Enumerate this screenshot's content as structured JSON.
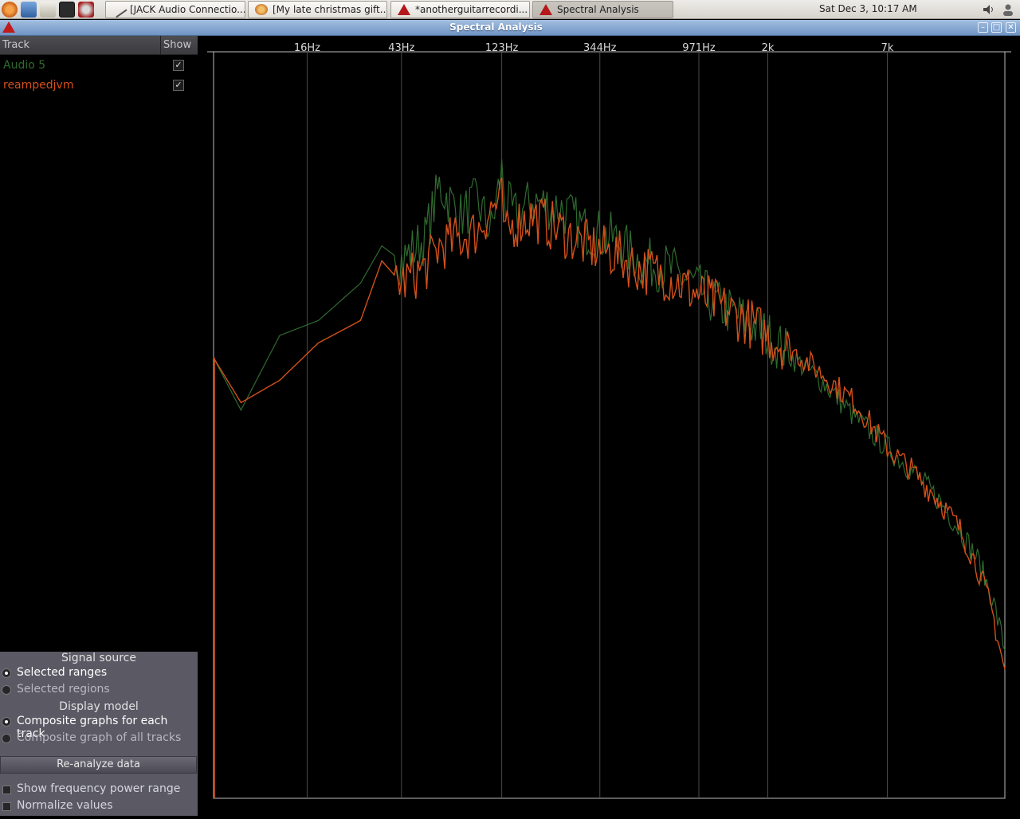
{
  "taskbar": {
    "tasks": [
      {
        "label": "[JACK Audio Connectio..."
      },
      {
        "label": "[My late christmas gift..."
      },
      {
        "label": "*anotherguitarrecordi..."
      },
      {
        "label": "Spectral Analysis"
      }
    ],
    "clock": "Sat Dec  3, 10:17 AM"
  },
  "window": {
    "title": "Spectral Analysis"
  },
  "track_list": {
    "col_track": "Track",
    "col_show": "Show",
    "tracks": [
      {
        "name": "Audio 5",
        "color": "#2f6b2f",
        "shown": true
      },
      {
        "name": "reampedjvm",
        "color": "#d4501a",
        "shown": true
      }
    ]
  },
  "controls": {
    "signal_source_label": "Signal source",
    "source_options": [
      "Selected ranges",
      "Selected regions"
    ],
    "source_selected": 0,
    "display_model_label": "Display model",
    "display_options": [
      "Composite graphs for each track",
      "Composite graph of all tracks"
    ],
    "display_selected": 0,
    "reanalyze_label": "Re-analyze data",
    "show_power_range_label": "Show frequency power range",
    "show_power_range": false,
    "normalize_label": "Normalize values",
    "normalize": false
  },
  "chart_data": {
    "type": "line",
    "x_scale": "log",
    "x_ticks": [
      "16Hz",
      "43Hz",
      "123Hz",
      "344Hz",
      "971Hz",
      "2k",
      "7k"
    ],
    "x_tick_values": [
      16,
      43,
      123,
      344,
      971,
      2000,
      7000
    ],
    "xlim": [
      6,
      24000
    ],
    "ylim": [
      0,
      100
    ],
    "grid": true,
    "series": [
      {
        "name": "Audio 5",
        "color": "#2f6b2f",
        "x": [
          6,
          8,
          12,
          18,
          28,
          35,
          43,
          55,
          64,
          80,
          95,
          110,
          123,
          128,
          140,
          170,
          230,
          300,
          400,
          520,
          700,
          900,
          1200,
          1600,
          2000,
          2600,
          3500,
          5000,
          7000,
          9000,
          12000,
          15000,
          18000,
          21000,
          24000
        ],
        "y": [
          59,
          52,
          62,
          64,
          69,
          74,
          72,
          75,
          82,
          78,
          80,
          76,
          84,
          80,
          78,
          80,
          79,
          76,
          75,
          72,
          71,
          69,
          66,
          64,
          62,
          59,
          56,
          51,
          47,
          44,
          40,
          36,
          32,
          27,
          20
        ]
      },
      {
        "name": "reampedjvm",
        "color": "#d4501a",
        "x": [
          6,
          8,
          12,
          18,
          28,
          35,
          43,
          55,
          64,
          80,
          95,
          110,
          123,
          128,
          140,
          170,
          230,
          300,
          400,
          520,
          700,
          900,
          1200,
          1600,
          2000,
          2600,
          3500,
          5000,
          7000,
          9000,
          12000,
          15000,
          18000,
          21000,
          24000
        ],
        "y": [
          59,
          53,
          56,
          61,
          64,
          72,
          69,
          71,
          74,
          75,
          76,
          79,
          80,
          75,
          77,
          78,
          76,
          74,
          73,
          71,
          70,
          68,
          66,
          64,
          62,
          60,
          57,
          53,
          47,
          44,
          40,
          36,
          31,
          25,
          17
        ]
      }
    ]
  }
}
